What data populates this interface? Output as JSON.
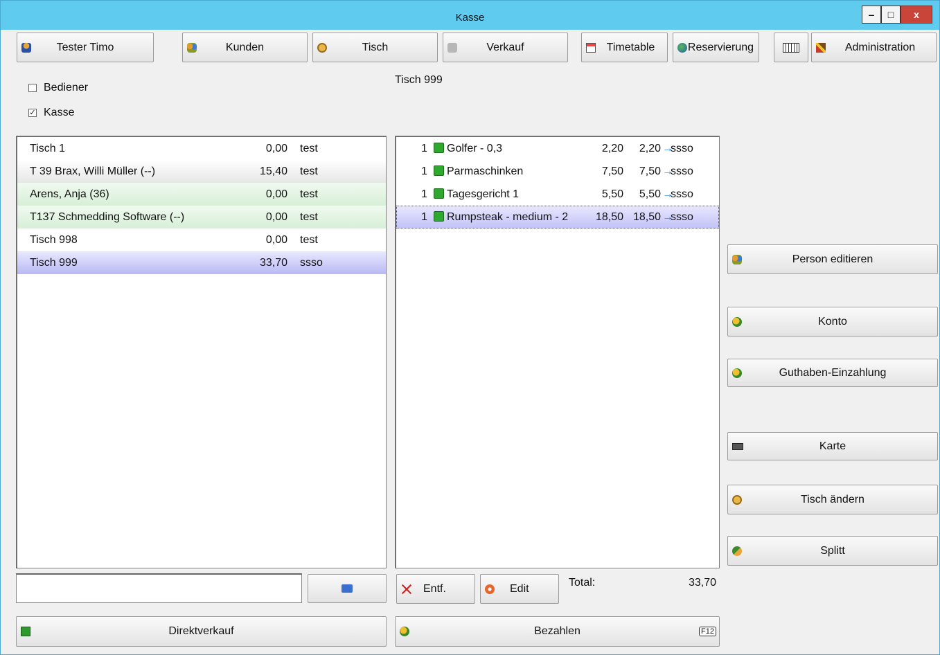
{
  "window": {
    "title": "Kasse"
  },
  "window_controls": {
    "minimize": "‒",
    "maximize": "□",
    "close": "x"
  },
  "toolbar": {
    "user": "Tester Timo",
    "kunden": "Kunden",
    "tisch": "Tisch",
    "verkauf": "Verkauf",
    "timetable": "Timetable",
    "reservierung": "Reservierung",
    "administration": "Administration"
  },
  "filters": {
    "bediener": {
      "label": "Bediener",
      "checked": false
    },
    "kasse": {
      "label": "Kasse",
      "checked": true
    }
  },
  "selected_table_title": "Tisch 999",
  "tables": [
    {
      "name": "Tisch   1",
      "amount": "0,00",
      "user": "test",
      "style": "white"
    },
    {
      "name": "T 39 Brax, Willi Müller (--)",
      "amount": "15,40",
      "user": "test",
      "style": "gray"
    },
    {
      "name": "Arens, Anja (36)",
      "amount": "0,00",
      "user": "test",
      "style": "green"
    },
    {
      "name": "T137 Schmedding Software (--)",
      "amount": "0,00",
      "user": "test",
      "style": "green"
    },
    {
      "name": "Tisch 998",
      "amount": "0,00",
      "user": "test",
      "style": "white"
    },
    {
      "name": "Tisch 999",
      "amount": "33,70",
      "user": "ssso",
      "style": "sel"
    }
  ],
  "order_items": [
    {
      "qty": "1",
      "name": "Golfer - 0,3",
      "price": "2,20",
      "total": "2,20",
      "arrow": "→",
      "user": "ssso"
    },
    {
      "qty": "1",
      "name": "Parmaschinken",
      "price": "7,50",
      "total": "7,50",
      "arrow": "→",
      "user": "ssso"
    },
    {
      "qty": "1",
      "name": "Tagesgericht 1",
      "price": "5,50",
      "total": "5,50",
      "arrow": "→",
      "user": "ssso"
    },
    {
      "qty": "1",
      "name": "Rumpsteak - medium - 2",
      "price": "18,50",
      "total": "18,50",
      "arrow": "→",
      "user": "ssso"
    }
  ],
  "actions": {
    "person_edit": "Person editieren",
    "konto": "Konto",
    "guthaben": "Guthaben-Einzahlung",
    "karte": "Karte",
    "tisch_aendern": "Tisch ändern",
    "splitt": "Splitt"
  },
  "bottom": {
    "search_value": "",
    "entf": "Entf.",
    "edit": "Edit",
    "total_label": "Total:",
    "total_value": "33,70",
    "direktverkauf": "Direktverkauf",
    "bezahlen": "Bezahlen",
    "bezahlen_key": "F12"
  },
  "icons": {
    "user": "person-icon",
    "kunden": "people-icon",
    "tisch": "table-icon",
    "verkauf": "sale-icon",
    "timetable": "calendar-icon",
    "reservierung": "globe-icon",
    "keyboard": "keyboard-icon",
    "administration": "tools-icon",
    "print": "printer-icon",
    "delete": "delete-icon",
    "edit": "edit-icon"
  }
}
